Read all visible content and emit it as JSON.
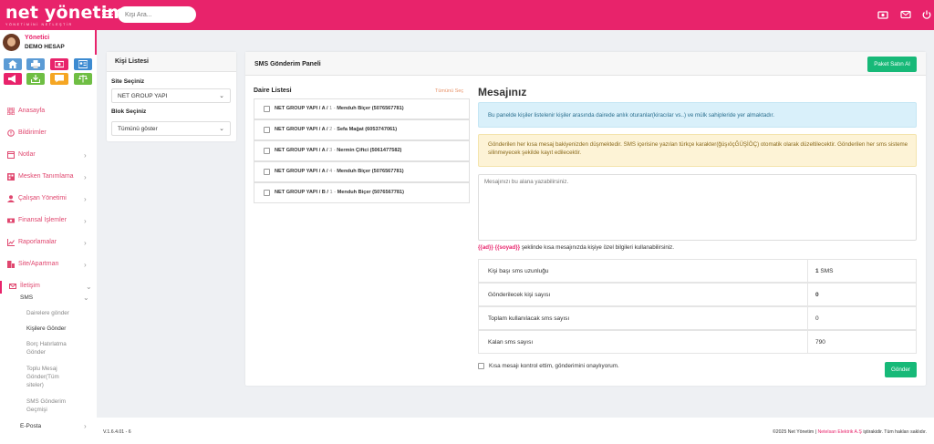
{
  "header": {
    "brand": "net yönetim",
    "tagline": "YÖNETİMİNİ NETLEŞTİR",
    "search_placeholder": "Kişi Ara...",
    "icons": [
      "money-icon",
      "mail-icon",
      "power-icon"
    ]
  },
  "user": {
    "name": "Yönetici",
    "role": "DEMO HESAP"
  },
  "sidebar": {
    "items": [
      {
        "label": "Anasayfa",
        "icon": "grid-icon",
        "chevron": false
      },
      {
        "label": "Bildirimler",
        "icon": "alert-icon",
        "chevron": false
      },
      {
        "label": "Notlar",
        "icon": "note-icon",
        "chevron": true
      },
      {
        "label": "Mesken Tanımlama",
        "icon": "building-icon",
        "chevron": true
      },
      {
        "label": "Çalışan Yönetimi",
        "icon": "users-icon",
        "chevron": true
      },
      {
        "label": "Finansal İşlemler",
        "icon": "money-icon",
        "chevron": true
      },
      {
        "label": "Raporlamalar",
        "icon": "chart-icon",
        "chevron": true
      },
      {
        "label": "Site/Apartman",
        "icon": "city-icon",
        "chevron": true
      },
      {
        "label": "İletişim",
        "icon": "envelope-icon",
        "chevron": true
      }
    ],
    "sms": "SMS",
    "sms_items": [
      "Dairelere gönder",
      "Kişilere Gönder",
      "Borç Hatırlatma Gönder",
      "Toplu Mesaj Gönder(Tüm siteler)",
      "SMS Gönderim Geçmişi"
    ],
    "eposta": "E-Posta"
  },
  "kisi": {
    "title": "Kişi Listesi",
    "site_label": "Site Seçiniz",
    "site_value": "NET GROUP YAPI",
    "blok_label": "Blok Seçiniz",
    "blok_value": "Tümünü göster"
  },
  "panel": {
    "title": "SMS Gönderim Paneli",
    "buy_button": "Paket Satın Al",
    "daire_title": "Daire Listesi",
    "select_all": "Tümünü Seç",
    "daireler": [
      {
        "loc": "NET GROUP YAPI / A / ",
        "no": "1",
        "sep": " - ",
        "name": "Menduh Biçer (5076567781)"
      },
      {
        "loc": "NET GROUP YAPI / A / ",
        "no": "2",
        "sep": " - ",
        "name": "Sefa Mağat (6053747061)"
      },
      {
        "loc": "NET GROUP YAPI / A / ",
        "no": "3",
        "sep": " - ",
        "name": "Nermin Çiftci (5061477582)"
      },
      {
        "loc": "NET GROUP YAPI / A / ",
        "no": "4",
        "sep": " - ",
        "name": "Menduh Biçer (5076567781)"
      },
      {
        "loc": "NET GROUP YAPI / B / ",
        "no": "1",
        "sep": " - ",
        "name": "Menduh Biçer (5076567781)"
      }
    ],
    "message_title": "Mesajınız",
    "info_text": "Bu panelde kişiler listelenir kişiler arasında dairede anlık oturanlar(kiracılar vs..) ve mülk sahipleride yer almaktadır.",
    "warn_text": "Gönderilen her kısa mesaj bakiyenizden düşmektedir. SMS içerisine yazılan türkçe karakter(ğüşıöçĞÜŞİÖÇ) otomatik olarak düzeltilecektir. Gönderilen her sms sisteme silinmeyecek şekilde kayıt edilecektir.",
    "textarea_placeholder": "Mesajınızı bu alana yazabilirsiniz.",
    "hint_tags": "{{ad}} {{soyad}}",
    "hint_text": " şeklinde kısa mesajınızda kişiye özel bilgileri kullanabilirsiniz.",
    "stats": [
      {
        "label": "Kişi başı sms uzunluğu",
        "value_bold": "1",
        "value": " SMS"
      },
      {
        "label": "Gönderilecek kişi sayısı",
        "value_bold": "0",
        "value": ""
      },
      {
        "label": "Toplam kullanılacak sms sayısı",
        "value_bold": "",
        "value": "0"
      },
      {
        "label": "Kalan sms sayısı",
        "value_bold": "",
        "value": "790"
      }
    ],
    "confirm_text": "Kısa mesajı kontrol ettim, gönderimini onaylıyorum.",
    "send_button": "Gönder"
  },
  "footer": {
    "version": "V.1.6.4.01 - 6",
    "copyright_pre": "©2025 Net Yönetim | ",
    "company": "Netelsan Elektrik A.Ş",
    "copyright_post": " iştirakidir. Tüm hakları saklıdır."
  },
  "colors": {
    "brand": "#e8236b",
    "green": "#17b978",
    "info_bg": "#d9f0fa",
    "warn_bg": "#fdf3d6"
  }
}
